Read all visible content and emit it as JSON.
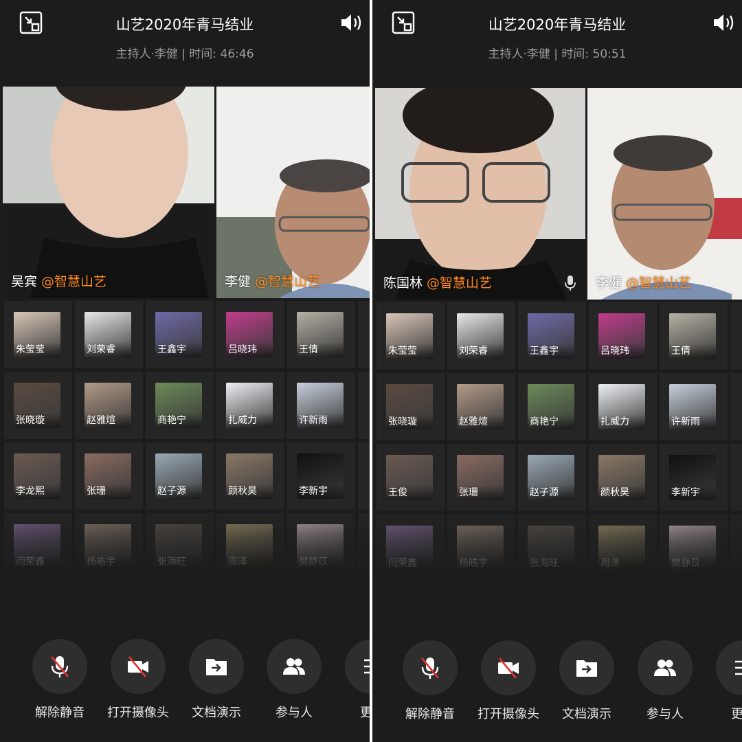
{
  "left": {
    "title": "山艺2020年青马结业",
    "subtitle": "主持人·李健 | 时间: 46:46",
    "videos": [
      {
        "name": "吴宾",
        "tag": "@智慧山艺"
      },
      {
        "name": "李健",
        "tag": "@智慧山艺"
      }
    ],
    "participants": [
      "朱莹莹",
      "刘荣睿",
      "王鑫宇",
      "吕晓玮",
      "王倩",
      "张晓璇",
      "赵雅煊",
      "商艳宁",
      "扎威力",
      "许新雨",
      "李龙熙",
      "张珊",
      "赵子源",
      "颜秋昊",
      "李新宇",
      "闫荣鑫",
      "杨皓宇",
      "张海旺",
      "周泽",
      "樊静苡"
    ]
  },
  "right": {
    "title": "山艺2020年青马结业",
    "subtitle": "主持人·李健 | 时间: 50:51",
    "videos": [
      {
        "name": "陈国林",
        "tag": "@智慧山艺"
      },
      {
        "name": "李健",
        "tag": "@智慧山艺"
      }
    ],
    "participants": [
      "朱莹莹",
      "刘荣睿",
      "王鑫宇",
      "吕晓玮",
      "王倩",
      "张晓璇",
      "赵雅煊",
      "商艳宁",
      "扎威力",
      "许新雨",
      "王俊",
      "张珊",
      "赵子源",
      "颜秋昊",
      "李新宇",
      "闫荣鑫",
      "杨皓宇",
      "张海旺",
      "周泽",
      "樊静苡"
    ]
  },
  "controls": {
    "unmute": "解除静音",
    "camera": "打开摄像头",
    "share": "文档演示",
    "participants": "参与人",
    "more": "更多"
  },
  "icons": [
    "exit-fullscreen-icon",
    "speaker-icon",
    "mic-muted-icon",
    "camera-off-icon",
    "share-doc-icon",
    "participants-icon",
    "more-icon",
    "mic-icon"
  ],
  "colors": {
    "background": "#1c1c1c",
    "tag": "#ff8a1f",
    "text": "#ffffff",
    "subtext": "#9a9a9a"
  }
}
